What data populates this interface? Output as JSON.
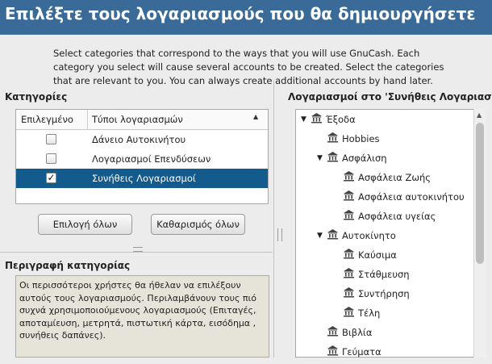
{
  "header": {
    "title": "Επιλέξτε τους λογαριασμούς που θα δημιουργήσετε"
  },
  "intro": {
    "lines": [
      "Select categories that correspond to the ways that you will use GnuCash. Each",
      "category you select will cause several accounts to be created. Select the categories",
      "that are relevant to you. You can always create additional accounts by hand later."
    ]
  },
  "categories": {
    "label": "Κατηγορίες",
    "col_selected": "Επιλεγμένο",
    "col_type": "Τύποι λογαριασμών",
    "rows": [
      {
        "name": "Δάνειο Αυτοκινήτου",
        "checked": false,
        "selected": false
      },
      {
        "name": "Λογαριασμοί Επενδύσεων",
        "checked": false,
        "selected": false
      },
      {
        "name": "Συνήθεις Λογαριασμοί",
        "checked": true,
        "selected": true
      }
    ],
    "select_all": "Επιλογή όλων",
    "clear_all": "Καθαρισμός όλων"
  },
  "description": {
    "label": "Περιγραφή κατηγορίας",
    "lines": [
      "Οι περισσότεροι χρήστες θα ήθελαν να επιλέξουν",
      "αυτούς τους λογαριασμούς. Περιλαμβάνουν τους πιό",
      "συχνά χρησιμοποιούμενους λογαριασμούς (Επιταγές,",
      "αποταμίευση, μετρητά, πιστωτική κάρτα, εισόδημα ,",
      "συνήθεις δαπάνες)."
    ]
  },
  "tree": {
    "label": "Λογαριασμοί στο 'Συνήθεις Λογαριασμοί'",
    "items": [
      {
        "name": "Έξοδα",
        "level": 0,
        "expander": "expanded"
      },
      {
        "name": "Hobbies",
        "level": 1,
        "expander": "none"
      },
      {
        "name": "Ασφάλιση",
        "level": 1,
        "expander": "expanded"
      },
      {
        "name": "Ασφάλεια Ζωής",
        "level": 2,
        "expander": "none"
      },
      {
        "name": "Ασφάλεια αυτοκινήτου",
        "level": 2,
        "expander": "none"
      },
      {
        "name": "Ασφάλεια υγείας",
        "level": 2,
        "expander": "none"
      },
      {
        "name": "Αυτοκίνητο",
        "level": 1,
        "expander": "expanded"
      },
      {
        "name": "Καύσιμα",
        "level": 2,
        "expander": "none"
      },
      {
        "name": "Στάθμευση",
        "level": 2,
        "expander": "none"
      },
      {
        "name": "Συντήρηση",
        "level": 2,
        "expander": "none"
      },
      {
        "name": "Τέλη",
        "level": 2,
        "expander": "none"
      },
      {
        "name": "Βιβλία",
        "level": 1,
        "expander": "none"
      },
      {
        "name": "Γεύματα",
        "level": 1,
        "expander": "none"
      }
    ]
  },
  "icons": {
    "account": "bank-icon",
    "expanded": "triangle-down-icon",
    "sort": "sort-ascending-icon"
  },
  "colors": {
    "header": "#3a6a97",
    "selection": "#135a8d"
  }
}
